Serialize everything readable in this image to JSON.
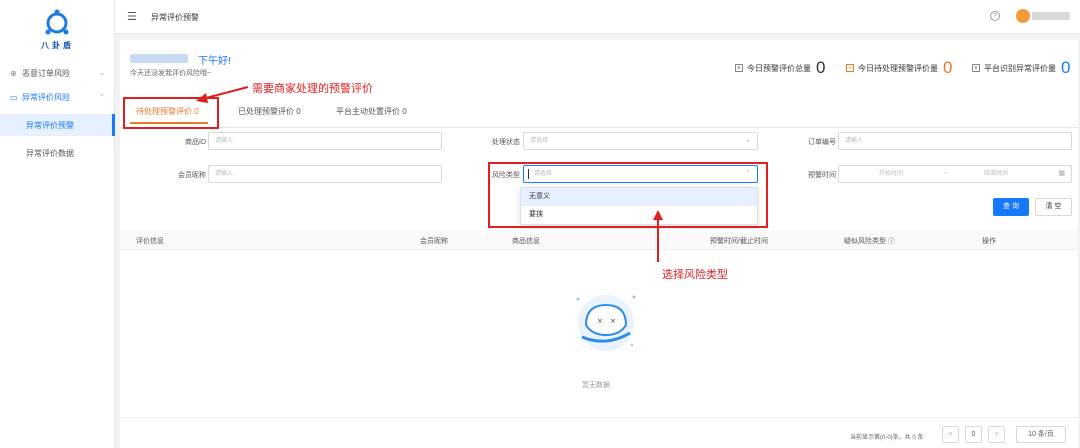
{
  "sidebar": {
    "logo_text": "八卦盾",
    "items": [
      {
        "label": "恶意订单风险",
        "icon": "shield-icon"
      },
      {
        "label": "异常评价风险",
        "icon": "monitor-icon"
      },
      {
        "label": "异常评价预警"
      },
      {
        "label": "异常评价数据"
      }
    ]
  },
  "header": {
    "title": "异常评价预警"
  },
  "greeting": {
    "text": "下午好!",
    "sub": "今天还没发我评价风险哦~"
  },
  "stats": [
    {
      "label": "今日预警评价总量",
      "value": "0"
    },
    {
      "label": "今日待处理预警评价量",
      "value": "0"
    },
    {
      "label": "平台识别异常评价量",
      "value": "0"
    }
  ],
  "tabs": [
    {
      "label": "待处理预警评价 0"
    },
    {
      "label": "已处理预警评价 0"
    },
    {
      "label": "平台主动处置评价 0"
    }
  ],
  "filters": {
    "product_id": {
      "label": "商品ID",
      "placeholder": "请输入"
    },
    "status": {
      "label": "处理状态",
      "placeholder": "请选择"
    },
    "order_no": {
      "label": "订单编号",
      "placeholder": "请输入"
    },
    "member": {
      "label": "会员昵称",
      "placeholder": "请输入"
    },
    "risk_type": {
      "label": "风险类型",
      "placeholder": "请选择"
    },
    "warn_time": {
      "label": "预警时间",
      "start": "开始时间",
      "sep": "~",
      "end": "结束时间"
    }
  },
  "dropdown_options": [
    "无意义",
    "要挟"
  ],
  "buttons": {
    "query": "查 询",
    "clear": "清 空"
  },
  "table_headers": [
    "评价信息",
    "会员昵称",
    "商品信息",
    "预警时间/截止时间",
    "疑似风险类型 ⓘ",
    "操作"
  ],
  "empty_text": "暂无数据",
  "pagination": {
    "summary": "当前显示第(0-0)条，共 0 条",
    "page": "0",
    "prev": "<",
    "next": ">",
    "page_size": "10 条/页"
  },
  "annotations": {
    "top": "需要商家处理的预警评价",
    "middle": "选择风险类型"
  },
  "colors": {
    "primary": "#1677ff",
    "orange": "#e87a2e",
    "annotation": "#e02020"
  }
}
